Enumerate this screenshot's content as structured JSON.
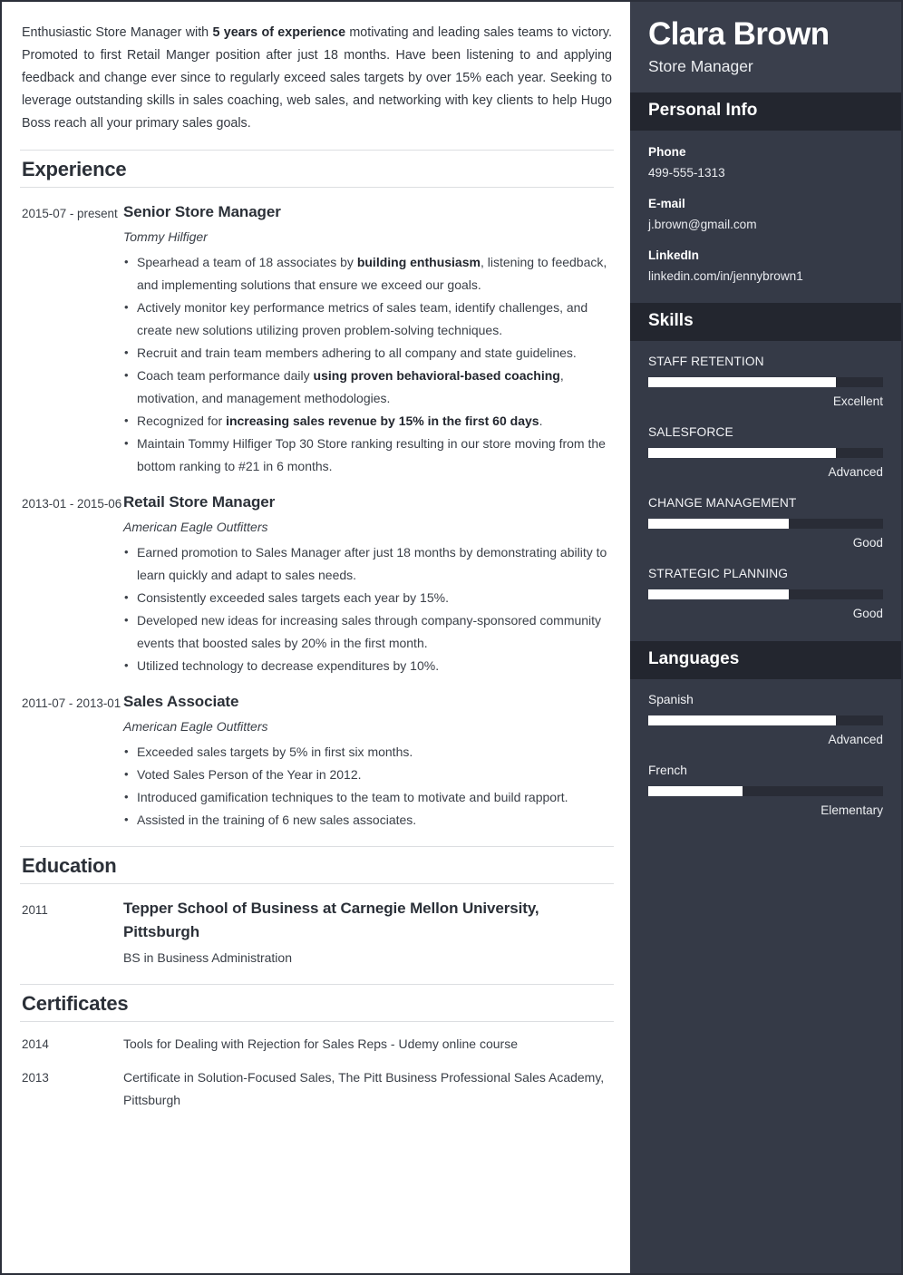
{
  "summary": {
    "parts": [
      {
        "t": "Enthusiastic Store Manager with ",
        "b": false
      },
      {
        "t": "5 years of experience",
        "b": true
      },
      {
        "t": " motivating and leading sales teams to victory. Promoted to first Retail Manger position after just 18 months. Have been listening to and applying feedback and change ever since to regularly exceed sales targets by over 15% each year. Seeking to leverage outstanding skills in sales coaching, web sales, and networking with key clients to help Hugo Boss reach all your primary sales goals.",
        "b": false
      }
    ]
  },
  "sections": {
    "experience_title": "Experience",
    "education_title": "Education",
    "certificates_title": "Certificates"
  },
  "experience": [
    {
      "date": "2015-07 - present",
      "title": "Senior Store Manager",
      "company": "Tommy Hilfiger",
      "bullets": [
        [
          {
            "t": "Spearhead a team of 18 associates by ",
            "b": false
          },
          {
            "t": "building enthusiasm",
            "b": true
          },
          {
            "t": ", listening to feedback, and implementing solutions that ensure we exceed our goals.",
            "b": false
          }
        ],
        [
          {
            "t": "Actively monitor key performance metrics of sales team, identify challenges, and create new solutions utilizing proven problem-solving techniques.",
            "b": false
          }
        ],
        [
          {
            "t": "Recruit and train team members adhering to all company and state guidelines.",
            "b": false
          }
        ],
        [
          {
            "t": "Coach team performance daily ",
            "b": false
          },
          {
            "t": "using proven behavioral-based coaching",
            "b": true
          },
          {
            "t": ", motivation, and management methodologies.",
            "b": false
          }
        ],
        [
          {
            "t": "Recognized for ",
            "b": false
          },
          {
            "t": "increasing sales revenue by 15% in the first 60 days",
            "b": true
          },
          {
            "t": ".",
            "b": false
          }
        ],
        [
          {
            "t": "Maintain Tommy Hilfiger Top 30 Store ranking resulting in our store moving from the bottom ranking to #21 in 6 months.",
            "b": false
          }
        ]
      ]
    },
    {
      "date": "2013-01 - 2015-06",
      "title": "Retail Store Manager",
      "company": "American Eagle Outfitters",
      "bullets": [
        [
          {
            "t": "Earned promotion to Sales Manager after just 18 months by demonstrating ability to learn quickly and adapt to sales needs.",
            "b": false
          }
        ],
        [
          {
            "t": "Consistently exceeded sales targets each year by 15%.",
            "b": false
          }
        ],
        [
          {
            "t": "Developed new ideas for increasing sales through company-sponsored community events that boosted sales by 20% in the first month.",
            "b": false
          }
        ],
        [
          {
            "t": "Utilized technology to decrease expenditures by 10%.",
            "b": false
          }
        ]
      ]
    },
    {
      "date": "2011-07 - 2013-01",
      "title": "Sales Associate",
      "company": "American Eagle Outfitters",
      "bullets": [
        [
          {
            "t": "Exceeded sales targets by 5% in first six months.",
            "b": false
          }
        ],
        [
          {
            "t": "Voted Sales Person of the Year in 2012.",
            "b": false
          }
        ],
        [
          {
            "t": "Introduced gamification techniques to the team to motivate and build rapport.",
            "b": false
          }
        ],
        [
          {
            "t": "Assisted in the training of 6 new sales associates.",
            "b": false
          }
        ]
      ]
    }
  ],
  "education": [
    {
      "date": "2011",
      "title": "Tepper School of Business at Carnegie Mellon University, Pittsburgh",
      "degree": "BS in Business Administration"
    }
  ],
  "certificates": [
    {
      "date": "2014",
      "text": "Tools for Dealing with Rejection for Sales Reps - Udemy online course"
    },
    {
      "date": "2013",
      "text": "Certificate in Solution-Focused Sales, The Pitt Business Professional Sales Academy, Pittsburgh"
    }
  ],
  "sidebar": {
    "name": "Clara Brown",
    "role": "Store Manager",
    "personal_info_title": "Personal Info",
    "contacts": [
      {
        "label": "Phone",
        "value": "499-555-1313"
      },
      {
        "label": "E-mail",
        "value": "j.brown@gmail.com"
      },
      {
        "label": "LinkedIn",
        "value": "linkedin.com/in/jennybrown1"
      }
    ],
    "skills_title": "Skills",
    "skills": [
      {
        "name": "STAFF RETENTION",
        "level": "Excellent",
        "percent": 80
      },
      {
        "name": "SALESFORCE",
        "level": "Advanced",
        "percent": 80
      },
      {
        "name": "CHANGE MANAGEMENT",
        "level": "Good",
        "percent": 60
      },
      {
        "name": "STRATEGIC PLANNING",
        "level": "Good",
        "percent": 60
      }
    ],
    "languages_title": "Languages",
    "languages": [
      {
        "name": "Spanish",
        "level": "Advanced",
        "percent": 80
      },
      {
        "name": "French",
        "level": "Elementary",
        "percent": 40
      }
    ]
  },
  "colors": {
    "sidebar_bg": "#353a47",
    "sidebar_header_bg": "#3a3f4c",
    "sidebar_bar_bg": "#23262f",
    "track": "#292c36",
    "fill": "#ffffff",
    "text_dark": "#2b3038"
  }
}
